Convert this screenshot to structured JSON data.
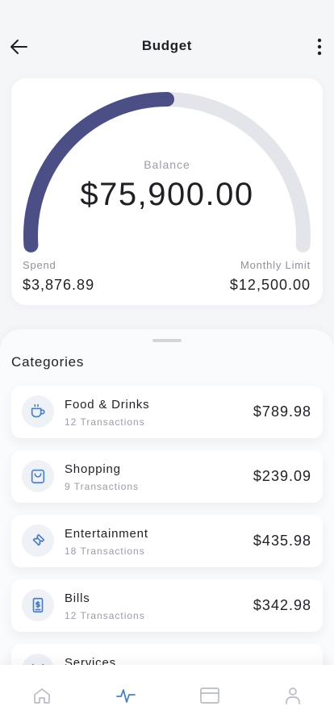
{
  "header": {
    "title": "Budget",
    "back_icon": "arrow-left-icon",
    "menu_icon": "more-vertical-icon"
  },
  "balance": {
    "label": "Balance",
    "value": "$75,900.00",
    "spend_label": "Spend",
    "spend_value": "$3,876.89",
    "limit_label": "Monthly Limit",
    "limit_value": "$12,500.00",
    "gauge_progress": 0.5,
    "colors": {
      "gauge_fill": "#4b4f86",
      "gauge_track": "#e4e5ea"
    }
  },
  "categories": {
    "title": "Categories",
    "items": [
      {
        "name": "Food & Drinks",
        "count": "12 Transactions",
        "amount": "$789.98",
        "icon": "coffee-cup-icon"
      },
      {
        "name": "Shopping",
        "count": "9 Transactions",
        "amount": "$239.09",
        "icon": "shopping-bag-icon"
      },
      {
        "name": "Entertainment",
        "count": "18 Transactions",
        "amount": "$435.98",
        "icon": "ticket-icon"
      },
      {
        "name": "Bills",
        "count": "12 Transactions",
        "amount": "$342.98",
        "icon": "receipt-icon"
      },
      {
        "name": "Services",
        "count": "",
        "amount": "",
        "icon": "tools-icon"
      }
    ],
    "colors": {
      "icon_stroke": "#4a7ec4",
      "icon_bg": "#eef1f6"
    }
  },
  "bottom_nav": {
    "items": [
      {
        "icon": "home-icon",
        "active": false
      },
      {
        "icon": "activity-icon",
        "active": true
      },
      {
        "icon": "card-icon",
        "active": false
      },
      {
        "icon": "user-icon",
        "active": false
      }
    ],
    "colors": {
      "active": "#4a7ec4",
      "inactive": "#b9bcc4"
    }
  }
}
